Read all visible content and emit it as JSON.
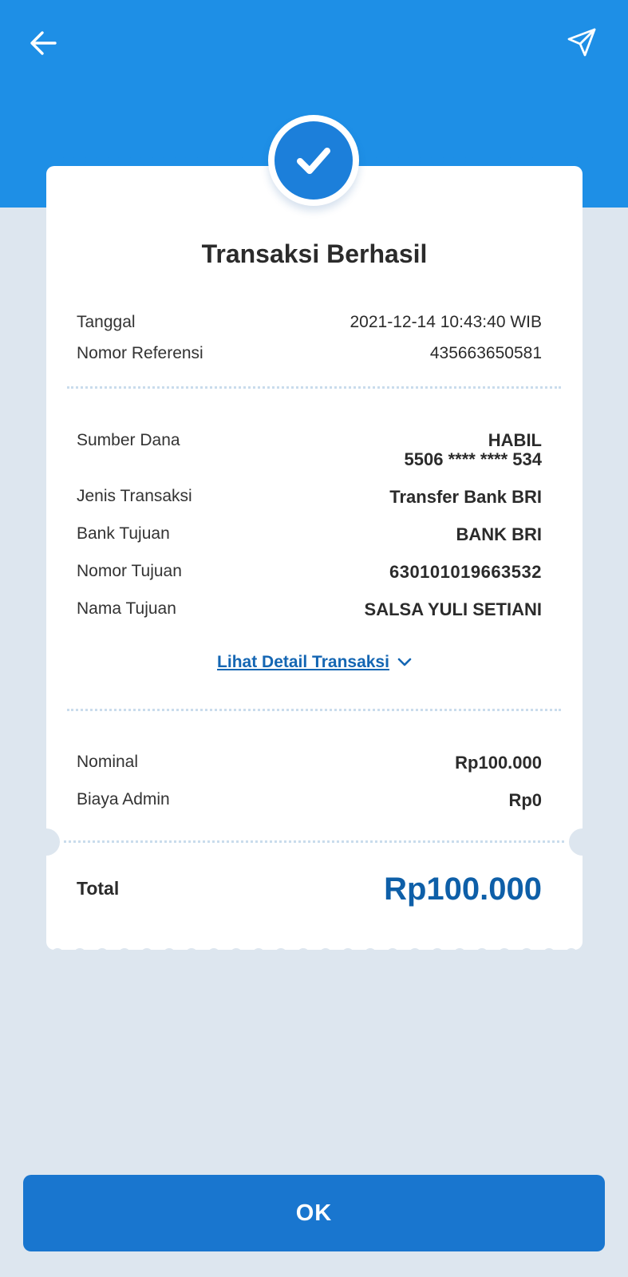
{
  "header": {
    "back_icon": "arrow-left-icon",
    "share_icon": "send-icon",
    "background_color": "#1e8fe6"
  },
  "status": {
    "icon": "check-circle-icon",
    "title": "Transaksi Berhasil"
  },
  "meta": [
    {
      "label": "Tanggal",
      "value": "2021-12-14 10:43:40 WIB"
    },
    {
      "label": "Nomor Referensi",
      "value": "435663650581"
    }
  ],
  "details": {
    "source": {
      "label": "Sumber Dana",
      "name": "HABIL",
      "card": "5506 **** **** 534"
    },
    "items": [
      {
        "label": "Jenis Transaksi",
        "value": "Transfer Bank BRI"
      },
      {
        "label": "Bank Tujuan",
        "value": "BANK BRI"
      },
      {
        "label": "Nomor Tujuan",
        "value": "630101019663532"
      },
      {
        "label": "Nama Tujuan",
        "value": "SALSA YULI SETIANI"
      }
    ],
    "detail_link": "Lihat Detail Transaksi",
    "detail_link_icon": "chevron-down-icon"
  },
  "amounts": [
    {
      "label": "Nominal",
      "value": "Rp100.000"
    },
    {
      "label": "Biaya Admin",
      "value": "Rp0"
    }
  ],
  "total": {
    "label": "Total",
    "value": "Rp100.000",
    "color": "#0e5fa8"
  },
  "ok_button": {
    "label": "OK",
    "color": "#1976cf"
  }
}
